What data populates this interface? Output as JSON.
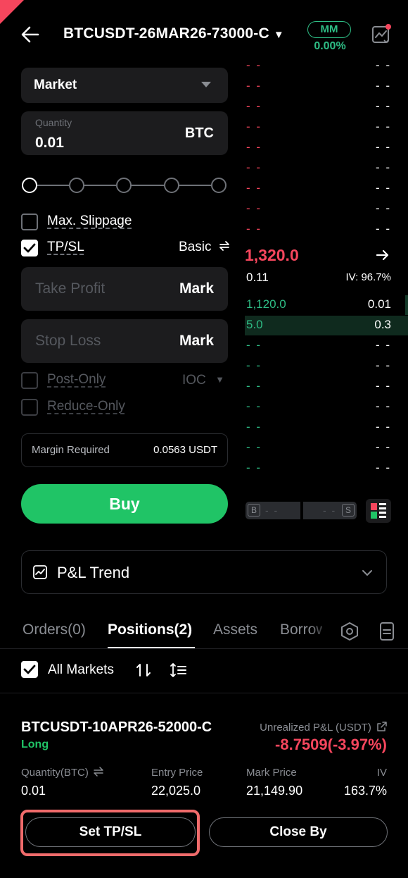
{
  "header": {
    "instrument": "BTCUSDT-26MAR26-73000-C",
    "mm_label": "MM",
    "mm_percent": "0.00%"
  },
  "order_form": {
    "order_type": "Market",
    "quantity_placeholder": "Quantity",
    "quantity_value": "0.01",
    "quantity_unit": "BTC",
    "max_slippage_label": "Max. Slippage",
    "tpsl_label": "TP/SL",
    "tpsl_mode": "Basic",
    "take_profit_placeholder": "Take Profit",
    "take_profit_trigger": "Mark",
    "stop_loss_placeholder": "Stop Loss",
    "stop_loss_trigger": "Mark",
    "post_only_label": "Post-Only",
    "time_in_force": "IOC",
    "reduce_only_label": "Reduce-Only",
    "margin_label": "Margin Required",
    "margin_value": "0.0563 USDT",
    "buy_label": "Buy"
  },
  "orderbook": {
    "asks": [
      {
        "price": "- -",
        "size": "- -"
      },
      {
        "price": "- -",
        "size": "- -"
      },
      {
        "price": "- -",
        "size": "- -"
      },
      {
        "price": "- -",
        "size": "- -"
      },
      {
        "price": "- -",
        "size": "- -"
      },
      {
        "price": "- -",
        "size": "- -"
      },
      {
        "price": "- -",
        "size": "- -"
      },
      {
        "price": "- -",
        "size": "- -"
      },
      {
        "price": "- -",
        "size": "- -"
      }
    ],
    "last_price": "1,320.0",
    "mark_price": "0.11",
    "iv": "IV: 96.7%",
    "bids": [
      {
        "price": "1,120.0",
        "size": "0.01"
      },
      {
        "price": "5.0",
        "size": "0.3"
      },
      {
        "price": "- -",
        "size": "- -"
      },
      {
        "price": "- -",
        "size": "- -"
      },
      {
        "price": "- -",
        "size": "- -"
      },
      {
        "price": "- -",
        "size": "- -"
      },
      {
        "price": "- -",
        "size": "- -"
      },
      {
        "price": "- -",
        "size": "- -"
      },
      {
        "price": "- -",
        "size": "- -"
      }
    ],
    "buy_tag": "B",
    "sell_tag": "S",
    "buy_ratio": "- -",
    "sell_ratio": "- -"
  },
  "pnl_trend_label": "P&L Trend",
  "tabs": [
    {
      "label": "Orders(0)"
    },
    {
      "label": "Positions(2)"
    },
    {
      "label": "Assets"
    },
    {
      "label": "Borrow"
    }
  ],
  "filter": {
    "all_markets_label": "All Markets"
  },
  "position": {
    "instrument": "BTCUSDT-10APR26-52000-C",
    "side": "Long",
    "upl_label": "Unrealized P&L (USDT)",
    "upl_value": "-8.7509(-3.97%)",
    "qty_header": "Quantity(BTC)",
    "qty_value": "0.01",
    "entry_header": "Entry Price",
    "entry_value": "22,025.0",
    "mark_header": "Mark Price",
    "mark_value": "21,149.90",
    "iv_header": "IV",
    "iv_value": "163.7%",
    "set_tpsl_label": "Set TP/SL",
    "close_by_label": "Close By"
  },
  "colors": {
    "buy": "#20c466",
    "sell": "#f6465d",
    "highlight": "#f06b6b"
  }
}
